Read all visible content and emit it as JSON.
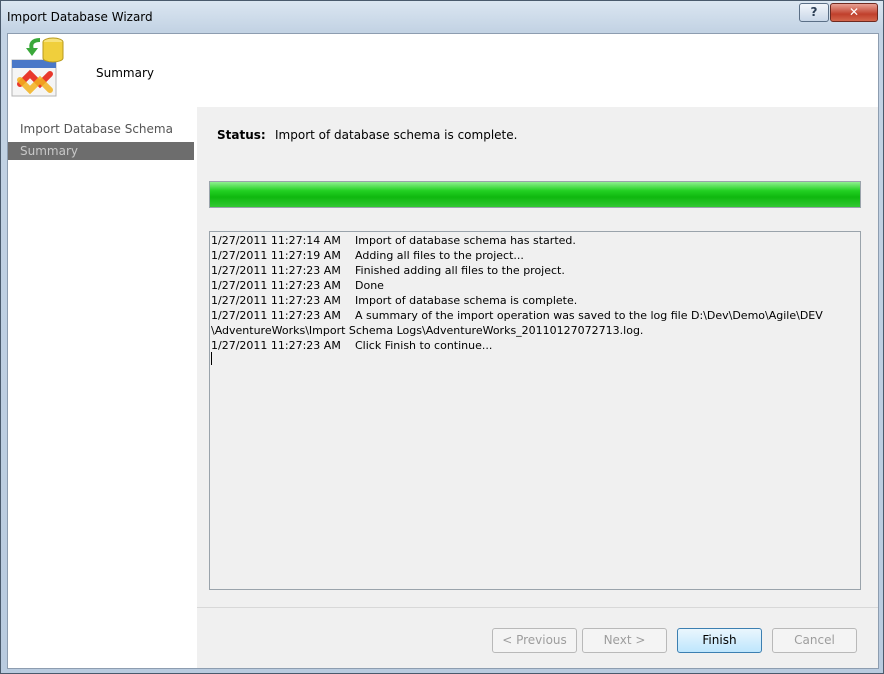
{
  "window": {
    "title": "Import Database Wizard",
    "help_label": "?",
    "close_label": "✕"
  },
  "header": {
    "title": "Summary"
  },
  "sidebar": {
    "items": [
      {
        "label": "Import Database Schema",
        "selected": false
      },
      {
        "label": "Summary",
        "selected": true
      }
    ]
  },
  "status": {
    "label": "Status:",
    "text": "Import of database schema is complete."
  },
  "progress": {
    "value_percent": 100,
    "color": "#22d022"
  },
  "log": {
    "entries": [
      {
        "time": "1/27/2011 11:27:14 AM",
        "message": "Import of database schema has started."
      },
      {
        "time": "1/27/2011 11:27:19 AM",
        "message": "Adding all files to the project..."
      },
      {
        "time": "1/27/2011 11:27:23 AM",
        "message": "Finished adding all files to the project."
      },
      {
        "time": "1/27/2011 11:27:23 AM",
        "message": "Done"
      },
      {
        "time": "1/27/2011 11:27:23 AM",
        "message": "Import of database schema is complete."
      },
      {
        "time": "1/27/2011 11:27:23 AM",
        "message": "A summary of the import operation was saved to the log file D:\\Dev\\Demo\\Agile\\DEV"
      },
      {
        "time": "",
        "message": "\\AdventureWorks\\Import Schema Logs\\AdventureWorks_20110127072713.log."
      },
      {
        "time": "1/27/2011 11:27:23 AM",
        "message": "Click Finish to continue..."
      }
    ]
  },
  "buttons": {
    "previous": "< Previous",
    "next": "Next >",
    "finish": "Finish",
    "cancel": "Cancel"
  }
}
